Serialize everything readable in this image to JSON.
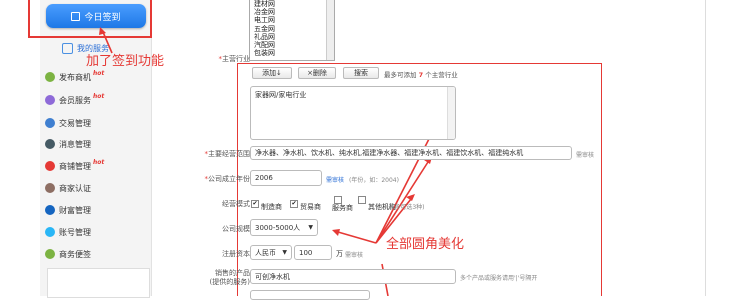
{
  "sidebar": {
    "checkin_label": "今日签到",
    "items": [
      {
        "label": "我的服务",
        "color": "#4a90e2",
        "hot": false,
        "active": true
      },
      {
        "label": "发布商机",
        "color": "#7cb342",
        "hot": true
      },
      {
        "label": "会员服务",
        "color": "#8e6ad8",
        "hot": true
      },
      {
        "label": "交易管理",
        "color": "#3f7fd0",
        "hot": false
      },
      {
        "label": "消息管理",
        "color": "#455a64",
        "hot": false
      },
      {
        "label": "商铺管理",
        "color": "#e53935",
        "hot": true
      },
      {
        "label": "商家认证",
        "color": "#8d6e63",
        "hot": false
      },
      {
        "label": "财富管理",
        "color": "#1565c0",
        "hot": false
      },
      {
        "label": "账号管理",
        "color": "#29b6f6",
        "hot": false
      },
      {
        "label": "商务便签",
        "color": "#7cb342",
        "hot": false
      }
    ],
    "hot_tag": "hot"
  },
  "annotations": {
    "checkin": "加了签到功能",
    "rounded": "全部圆角美化"
  },
  "form": {
    "industry_list": {
      "options": [
        "建材网",
        "冶金网",
        "电工网",
        "五金网",
        "礼品网",
        "汽配网",
        "包装网"
      ]
    },
    "main_industry": {
      "label": "主营行业",
      "add_button": "添加↓",
      "delete_button": "×删除",
      "search_button": "搜索",
      "limit_hint_prefix": "最多可添加",
      "limit_count": "7",
      "limit_hint_suffix": "个主营行业",
      "selected": "家器网/家电行业"
    },
    "scope": {
      "label": "主要经营范围",
      "value": "净水器、净水机、饮水机、纯水机,福建净水器、福建净水机、福建饮水机、福建纯水机",
      "hint": "需审核"
    },
    "founded_year": {
      "label": "公司成立年份",
      "value": "2006",
      "badge": "需审核",
      "hint": "(年份，如：2004)"
    },
    "business_mode": {
      "label": "经营模式",
      "options": [
        {
          "label": "制造商",
          "checked": true
        },
        {
          "label": "贸易商",
          "checked": true
        },
        {
          "label": "服务商",
          "checked": false
        },
        {
          "label": "其他机构",
          "checked": false
        }
      ],
      "hint": "(最多可选3种)"
    },
    "company_size": {
      "label": "公司规模",
      "value": "3000-5000人"
    },
    "capital": {
      "label": "注册资本",
      "currency": "人民币",
      "amount": "100",
      "unit": "万",
      "badge": "需审核"
    },
    "products": {
      "label": "销售的产品",
      "sublabel": "(提供的服务)",
      "value": "可创净水机",
      "hint": "多个产品或服务请用'|'号隔开"
    }
  }
}
